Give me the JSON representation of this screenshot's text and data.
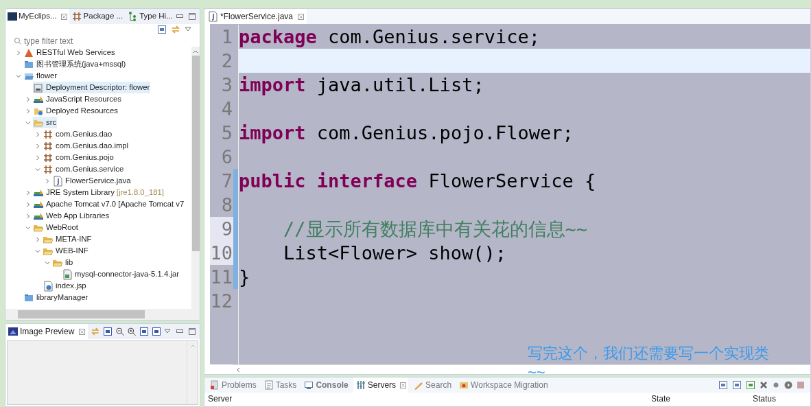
{
  "explorer": {
    "tabs": [
      {
        "label": "MyEclips...",
        "kind": "me",
        "selected": true
      },
      {
        "label": "Package ...",
        "kind": "package",
        "selected": false
      },
      {
        "label": "Type Hi...",
        "kind": "hierarchy",
        "selected": false
      }
    ],
    "filter": {
      "placeholder": "type filter text"
    },
    "tree": [
      {
        "label": "RESTful Web Services",
        "kind": "rest",
        "expanded": false,
        "selected": false
      },
      {
        "label": "图书管理系统(java+mssql)",
        "kind": "project",
        "selected": false
      },
      {
        "label": "flower",
        "kind": "project-open",
        "expanded": true,
        "selected": false,
        "children": [
          {
            "label": "Deployment Descriptor: flower",
            "kind": "descriptor",
            "selected": true
          },
          {
            "label": "JavaScript Resources",
            "kind": "library",
            "expanded": false,
            "selected": false
          },
          {
            "label": "Deployed Resources",
            "kind": "deployed",
            "expanded": false,
            "selected": false
          },
          {
            "label": "src",
            "kind": "src",
            "expanded": true,
            "selected": true,
            "children": [
              {
                "label": "com.Genius.dao",
                "kind": "package",
                "expanded": false,
                "selected": false
              },
              {
                "label": "com.Genius.dao.impl",
                "kind": "package",
                "expanded": false,
                "selected": false
              },
              {
                "label": "com.Genius.pojo",
                "kind": "package",
                "expanded": false,
                "selected": false
              },
              {
                "label": "com.Genius.service",
                "kind": "package",
                "expanded": true,
                "selected": false,
                "children": [
                  {
                    "label": "FlowerService.java",
                    "kind": "java",
                    "expanded": false,
                    "selected": false
                  }
                ]
              }
            ]
          },
          {
            "label": "JRE System Library",
            "decoration": "[jre1.8.0_181]",
            "kind": "library",
            "expanded": false,
            "selected": false
          },
          {
            "label": "Apache Tomcat v7.0 [Apache Tomcat v7",
            "kind": "library",
            "expanded": false,
            "selected": false
          },
          {
            "label": "Web App Libraries",
            "kind": "library",
            "expanded": false,
            "selected": false
          },
          {
            "label": "WebRoot",
            "kind": "folder",
            "expanded": true,
            "selected": false,
            "children": [
              {
                "label": "META-INF",
                "kind": "folder",
                "expanded": false,
                "selected": false
              },
              {
                "label": "WEB-INF",
                "kind": "folder",
                "expanded": true,
                "selected": false,
                "children": [
                  {
                    "label": "lib",
                    "kind": "folder",
                    "expanded": true,
                    "selected": false,
                    "children": [
                      {
                        "label": "mysql-connector-java-5.1.4.jar",
                        "kind": "jar",
                        "selected": false
                      }
                    ]
                  }
                ]
              },
              {
                "label": "index.jsp",
                "kind": "jsp",
                "selected": false
              }
            ]
          }
        ]
      },
      {
        "label": "libraryManager",
        "kind": "project",
        "selected": false
      }
    ]
  },
  "image_preview": {
    "tab": {
      "label": "Image Preview",
      "selected": true
    }
  },
  "editor": {
    "tab": {
      "label": "*FlowerService.java",
      "selected": true
    },
    "lines": [
      {
        "number": "1",
        "current": false,
        "changed": false,
        "number_highlighted": false,
        "indented": false,
        "tokens": [
          {
            "kind": "keyword",
            "text": "package"
          },
          {
            "kind": "plain",
            "text": "com.Genius.service;"
          }
        ]
      },
      {
        "number": "2",
        "current": true,
        "changed": false,
        "number_highlighted": false
      },
      {
        "number": "3",
        "current": false,
        "changed": false,
        "number_highlighted": false,
        "indented": false,
        "tokens": [
          {
            "kind": "keyword",
            "text": "import"
          },
          {
            "kind": "plain",
            "text": "java.util.List;"
          }
        ]
      },
      {
        "number": "4",
        "current": false,
        "changed": false,
        "number_highlighted": false
      },
      {
        "number": "5",
        "current": false,
        "changed": false,
        "number_highlighted": false,
        "indented": false,
        "tokens": [
          {
            "kind": "keyword",
            "text": "import"
          },
          {
            "kind": "plain",
            "text": "com.Genius.pojo.Flower;"
          }
        ]
      },
      {
        "number": "6",
        "current": false,
        "changed": false,
        "number_highlighted": false
      },
      {
        "number": "7",
        "current": false,
        "changed": true,
        "number_highlighted": false,
        "indented": false,
        "tokens": [
          {
            "kind": "keyword",
            "text": "public"
          },
          {
            "kind": "keyword",
            "text": "interface"
          },
          {
            "kind": "plain",
            "text": "FlowerService {"
          }
        ]
      },
      {
        "number": "8",
        "current": false,
        "changed": true,
        "number_highlighted": false
      },
      {
        "number": "9",
        "current": false,
        "changed": true,
        "number_highlighted": true,
        "indented": true,
        "tokens": [
          {
            "kind": "comment",
            "text": "//显示所有数据库中有关花的信息~~"
          }
        ]
      },
      {
        "number": "10",
        "current": false,
        "changed": true,
        "number_highlighted": true,
        "indented": true,
        "tokens": [
          {
            "kind": "plain",
            "text": "List<Flower> show();"
          }
        ]
      },
      {
        "number": "11",
        "current": false,
        "changed": true,
        "number_highlighted": false,
        "indented": false,
        "tokens": [
          {
            "kind": "plain",
            "text": "}"
          }
        ]
      },
      {
        "number": "12",
        "current": false,
        "changed": false,
        "number_highlighted": false
      }
    ]
  },
  "annotation": [
    "写完这个，我们还需要写一个实现类",
    "~~"
  ],
  "bottom_panel": {
    "tabs": [
      {
        "label": "Problems",
        "kind": "problems",
        "bold": false,
        "selected": false
      },
      {
        "label": "Tasks",
        "kind": "tasks",
        "bold": false,
        "selected": false
      },
      {
        "label": "Console",
        "kind": "console",
        "bold": true,
        "selected": false
      },
      {
        "label": "Servers",
        "kind": "servers",
        "bold": false,
        "selected": true
      },
      {
        "label": "Search",
        "kind": "search",
        "bold": false,
        "selected": false
      },
      {
        "label": "Workspace Migration",
        "kind": "migration",
        "bold": false,
        "selected": false
      }
    ],
    "columns": [
      "Server",
      "State",
      "Status"
    ]
  }
}
